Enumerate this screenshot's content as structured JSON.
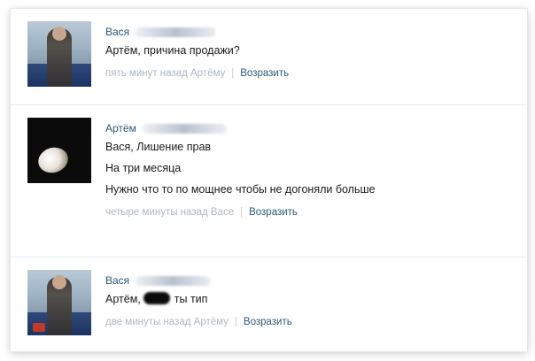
{
  "comments": [
    {
      "author": "Вася",
      "lines": [
        "Артём, причина продажи?"
      ],
      "time": "пять минут назад Артёму",
      "reply": "Возразить"
    },
    {
      "author": "Артём",
      "lines": [
        "Вася, Лишение прав",
        "На три месяца",
        "Нужно что то по мощнее чтобы не догоняли больше"
      ],
      "time": "четыре минуты назад Васе",
      "reply": "Возразить"
    },
    {
      "author": "Вася",
      "text_before": "Артём,",
      "text_after": "ты тип",
      "time": "две минуты назад Артёму",
      "reply": "Возразить"
    }
  ]
}
